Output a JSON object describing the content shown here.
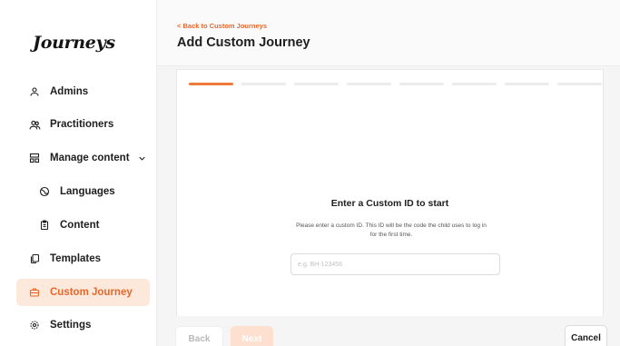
{
  "app": {
    "logo": "Journeys"
  },
  "sidebar": {
    "items": [
      {
        "label": "Admins",
        "icon": "user-icon"
      },
      {
        "label": "Practitioners",
        "icon": "users-icon"
      },
      {
        "label": "Manage content",
        "icon": "layout-icon",
        "expanded": true
      },
      {
        "label": "Languages",
        "icon": "globe-icon"
      },
      {
        "label": "Content",
        "icon": "clipboard-icon"
      },
      {
        "label": "Templates",
        "icon": "copy-icon"
      },
      {
        "label": "Custom Journey",
        "icon": "briefcase-icon",
        "active": true
      },
      {
        "label": "Settings",
        "icon": "gear-icon"
      }
    ]
  },
  "header": {
    "back_link": "Back to Custom Journeys",
    "title": "Add Custom Journey"
  },
  "card": {
    "steps_total": 8,
    "current_step": 1,
    "heading": "Enter a Custom ID to start",
    "description": "Please enter a custom ID. This ID will be the code the child uses to log in for the first time.",
    "input": {
      "placeholder": "e.g. BH-123456",
      "value": ""
    }
  },
  "footer": {
    "back_label": "Back",
    "next_label": "Next",
    "cancel_label": "Cancel"
  },
  "colors": {
    "accent": "#e9672a",
    "active_bg": "#fde9dc",
    "next_disabled_bg": "#fde0cf"
  }
}
